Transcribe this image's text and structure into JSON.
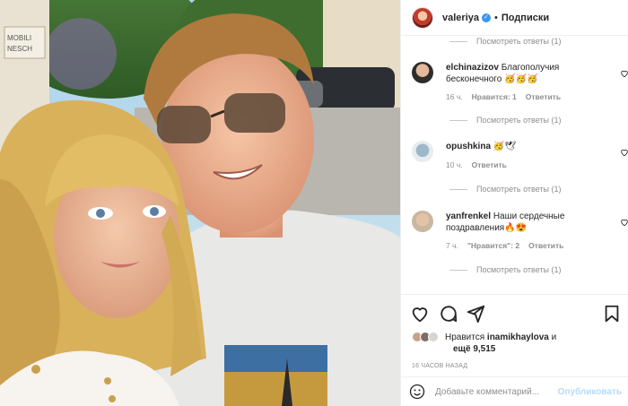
{
  "header": {
    "username": "valeriya",
    "separator": "•",
    "follow_label": "Подписки"
  },
  "comments": {
    "view_replies_label": "Посмотреть ответы (1)",
    "items": [
      {
        "username": "elchinazizov",
        "text": "Благополучия бесконечного 🥳🥳🥳",
        "time": "16 ч.",
        "likes": "Нравится: 1",
        "reply": "Ответить"
      },
      {
        "username": "opushkina",
        "text": "🥳🕊",
        "time": "10 ч.",
        "likes": "",
        "reply": "Ответить"
      },
      {
        "username": "yanfrenkel",
        "text": "Наши сердечные поздравления🔥😍",
        "time": "7 ч.",
        "likes": "\"Нравится\": 2",
        "reply": "Ответить"
      }
    ]
  },
  "likes": {
    "prefix": "Нравится",
    "user": "inamikhaylova",
    "suffix": "и",
    "more": "ещё 9,515"
  },
  "timestamp": "16 ЧАСОВ НАЗАД",
  "comment_box": {
    "placeholder": "Добавьте комментарий...",
    "publish_label": "Опубликовать"
  },
  "colors": {
    "verified": "#3897f0",
    "publish_disabled": "#b3dbff",
    "secondary_text": "#8e8e8e"
  },
  "icons": [
    "heart-icon",
    "comment-icon",
    "share-icon",
    "bookmark-icon",
    "emoji-icon",
    "verified-icon"
  ]
}
